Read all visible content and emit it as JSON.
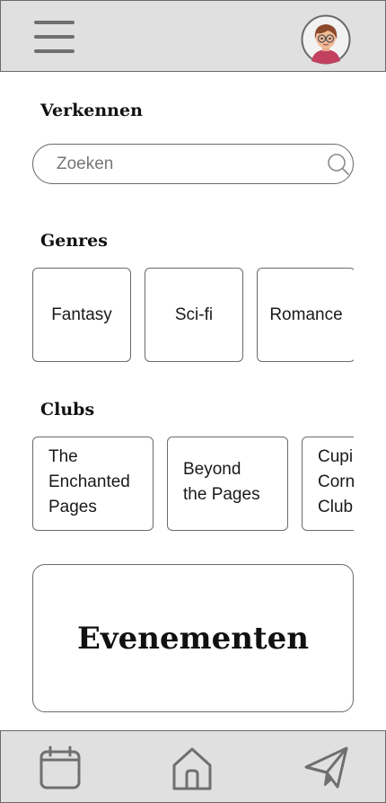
{
  "header": {
    "menu_icon": "hamburger-menu-icon",
    "avatar_icon": "user-avatar"
  },
  "explore": {
    "title": "Verkennen",
    "search_placeholder": "Zoeken",
    "search_icon": "search-icon"
  },
  "genres": {
    "title": "Genres",
    "items": [
      "Fantasy",
      "Sci-fi",
      "Romance"
    ]
  },
  "clubs": {
    "title": "Clubs",
    "items": [
      "The\nEnchanted\nPages",
      "Beyond\nthe Pages",
      "Cupid's\nCorner\nClub"
    ]
  },
  "events": {
    "label": "Evenementen"
  },
  "bottom_nav": {
    "items": [
      "calendar-icon",
      "home-icon",
      "send-icon"
    ]
  },
  "colors": {
    "bar_bg": "#e0e0e0",
    "border": "#6b6b6b",
    "icon": "#6f6f6f"
  }
}
